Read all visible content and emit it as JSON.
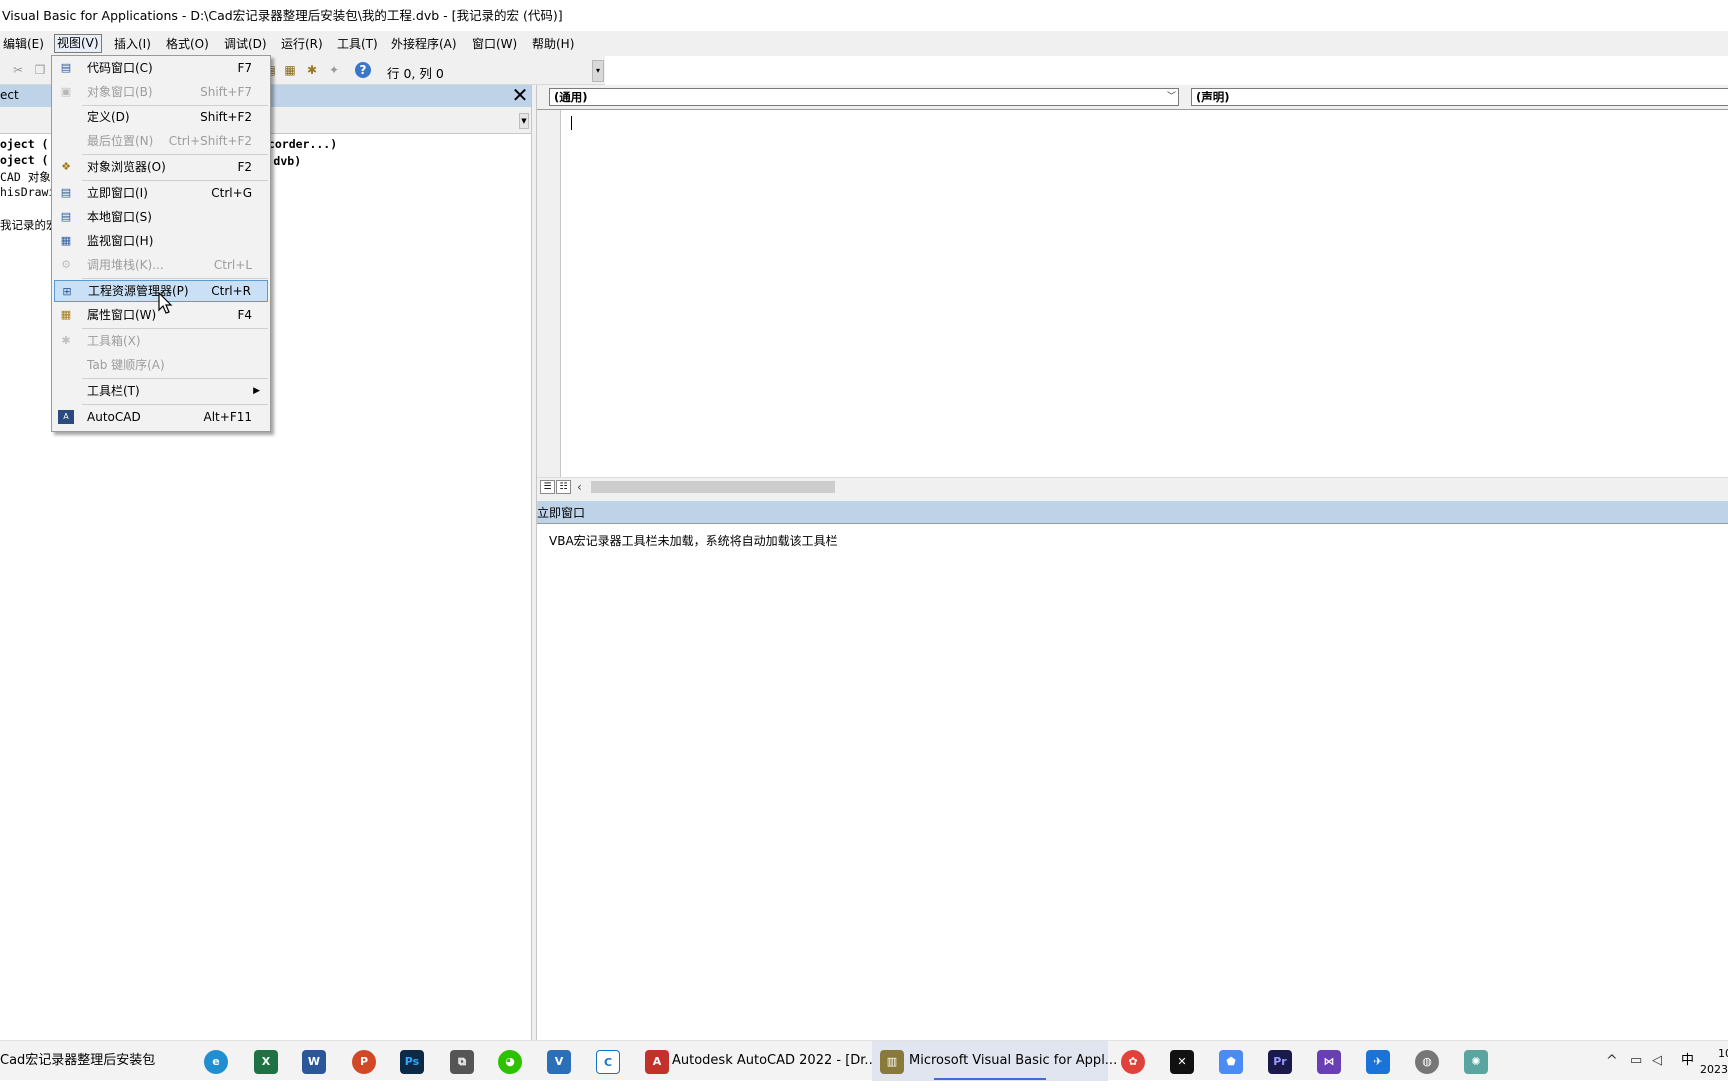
{
  "window": {
    "title": "Visual Basic for Applications - D:\\Cad宏记录器整理后安装包\\我的工程.dvb - [我记录的宏 (代码)]"
  },
  "menubar": {
    "items": [
      "编辑(E)",
      "视图(V)",
      "插入(I)",
      "格式(O)",
      "调试(D)",
      "运行(R)",
      "工具(T)",
      "外接程序(A)",
      "窗口(W)",
      "帮助(H)"
    ]
  },
  "toolbar": {
    "position": "行 0, 列 0"
  },
  "project": {
    "title": "ect",
    "tree": [
      "oject (",
      "oject (",
      "CAD 对象",
      "hisDrawi",
      "我记录的宏"
    ],
    "tree_right": [
      "ecorder...)",
      "程.dvb)"
    ]
  },
  "code": {
    "object_combo": "(通用)",
    "proc_combo": "(声明)"
  },
  "immediate": {
    "title": "立即窗口",
    "text": "VBA宏记录器工具栏未加载，系统将自动加载该工具栏"
  },
  "view_menu": {
    "items": [
      {
        "label": "代码窗口(C)",
        "shortcut": "F7",
        "icon": "code-window-icon",
        "enabled": true
      },
      {
        "label": "对象窗口(B)",
        "shortcut": "Shift+F7",
        "icon": "object-window-icon",
        "enabled": false
      },
      {
        "label": "定义(D)",
        "shortcut": "Shift+F2",
        "icon": "",
        "enabled": true
      },
      {
        "label": "最后位置(N)",
        "shortcut": "Ctrl+Shift+F2",
        "icon": "",
        "enabled": false
      },
      {
        "label": "对象浏览器(O)",
        "shortcut": "F2",
        "icon": "object-browser-icon",
        "enabled": true
      },
      {
        "label": "立即窗口(I)",
        "shortcut": "Ctrl+G",
        "icon": "immediate-window-icon",
        "enabled": true
      },
      {
        "label": "本地窗口(S)",
        "shortcut": "",
        "icon": "locals-window-icon",
        "enabled": true
      },
      {
        "label": "监视窗口(H)",
        "shortcut": "",
        "icon": "watch-window-icon",
        "enabled": true
      },
      {
        "label": "调用堆栈(K)...",
        "shortcut": "Ctrl+L",
        "icon": "call-stack-icon",
        "enabled": false
      },
      {
        "label": "工程资源管理器(P)",
        "shortcut": "Ctrl+R",
        "icon": "project-explorer-icon",
        "enabled": true
      },
      {
        "label": "属性窗口(W)",
        "shortcut": "F4",
        "icon": "properties-window-icon",
        "enabled": true
      },
      {
        "label": "工具箱(X)",
        "shortcut": "",
        "icon": "toolbox-icon",
        "enabled": false
      },
      {
        "label": "Tab 键顺序(A)",
        "shortcut": "",
        "icon": "",
        "enabled": false
      },
      {
        "label": "工具栏(T)",
        "shortcut": "",
        "icon": "",
        "enabled": true
      },
      {
        "label": "AutoCAD",
        "shortcut": "Alt+F11",
        "icon": "autocad-icon",
        "enabled": true
      }
    ]
  },
  "taskbar": {
    "folder": "Cad宏记录器整理后安装包",
    "autocad": "Autodesk AutoCAD 2022 - [Dr...",
    "vba": "Microsoft Visual Basic for Appl...",
    "tray_ime": "中",
    "clock_time": "10",
    "clock_year": "2023"
  },
  "colors": {
    "header": "#bed3e8",
    "highlight": "#c9e0f7",
    "accent": "#3a6fd8"
  }
}
